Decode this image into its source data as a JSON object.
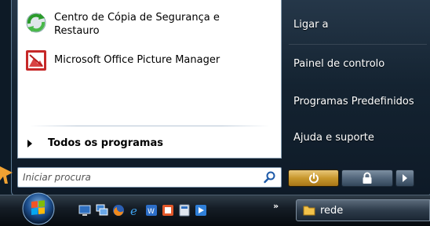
{
  "start_menu": {
    "programs": [
      {
        "label_line1": "Centro de Cópia de Segurança e",
        "label_line2": "Restauro",
        "icon": "backup-restore-icon"
      },
      {
        "label_line1": "Microsoft Office Picture Manager",
        "label_line2": "",
        "icon": "picture-manager-icon"
      }
    ],
    "all_programs": "Todos os programas",
    "search": {
      "placeholder": "Iniciar procura",
      "value": ""
    },
    "right_links": [
      "Ligar a",
      "Painel de controlo",
      "Programas Predefinidos",
      "Ajuda e suporte"
    ],
    "power_buttons": [
      "power-icon",
      "lock-icon",
      "arrow-right-icon"
    ]
  },
  "taskbar": {
    "start_orb": "windows-logo-icon",
    "quick_launch": [
      "show-desktop-icon",
      "switch-windows-icon",
      "firefox-icon",
      "internet-explorer-icon",
      "windows-media-player-icon",
      "office-icon",
      "calculator-icon",
      "media-center-icon"
    ],
    "overflow": "»",
    "open_window": {
      "label": "rede",
      "icon": "folder-icon"
    }
  },
  "colors": {
    "accent": "#c8982d",
    "right_pane": "#142331",
    "taskbar": "#151d26"
  }
}
